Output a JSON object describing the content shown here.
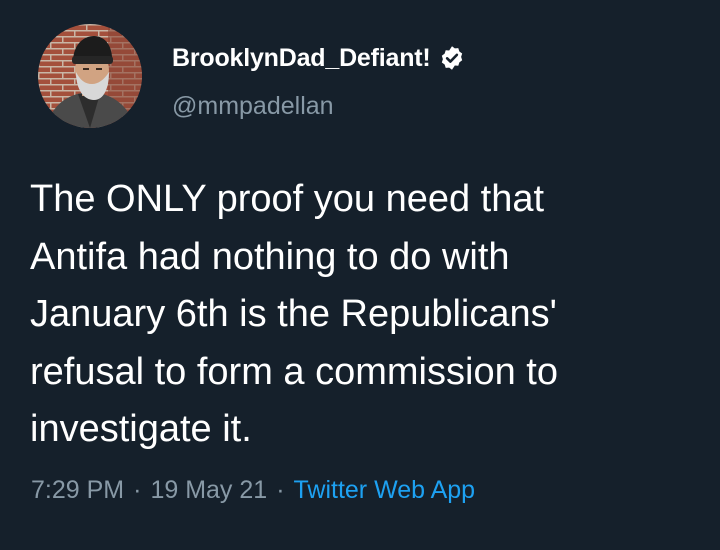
{
  "author": {
    "display_name": "BrooklynDad_Defiant!",
    "handle": "@mmpadellan",
    "verified": true,
    "avatar_icon": "profile-photo"
  },
  "tweet": {
    "lines": [
      "The ONLY proof you need that",
      "Antifa had nothing to do with",
      "January 6th is the Republicans'",
      "refusal to form a commission to",
      "investigate it."
    ]
  },
  "meta": {
    "time": "7:29 PM",
    "separator": "·",
    "date": "19 May 21",
    "source": "Twitter Web App"
  },
  "colors": {
    "background": "#15202b",
    "text": "#ffffff",
    "secondary_text": "#8899a6",
    "accent": "#1da1f2"
  }
}
